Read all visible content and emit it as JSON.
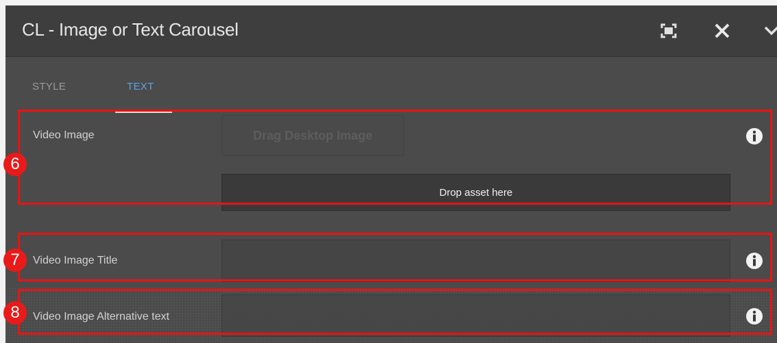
{
  "dialog": {
    "title": "CL - Image or Text Carousel"
  },
  "tabs": [
    {
      "label": "STYLE",
      "active": false
    },
    {
      "label": "TEXT",
      "active": true
    }
  ],
  "fields": {
    "video_image": {
      "label": "Video Image",
      "drag_button": "Drag Desktop Image",
      "drop_zone": "Drop asset here"
    },
    "video_image_title": {
      "label": "Video Image Title",
      "value": ""
    },
    "video_image_alt": {
      "label": "Video Image Alternative text",
      "value": ""
    }
  },
  "annotations": [
    "6",
    "7",
    "8"
  ],
  "colors": {
    "highlight": "#ee1111",
    "active_tab": "#5fa0e6",
    "dialog_bg": "#4b4b4b"
  },
  "icons": [
    "fullscreen-icon",
    "close-icon",
    "chevron-down-icon",
    "info-icon"
  ]
}
